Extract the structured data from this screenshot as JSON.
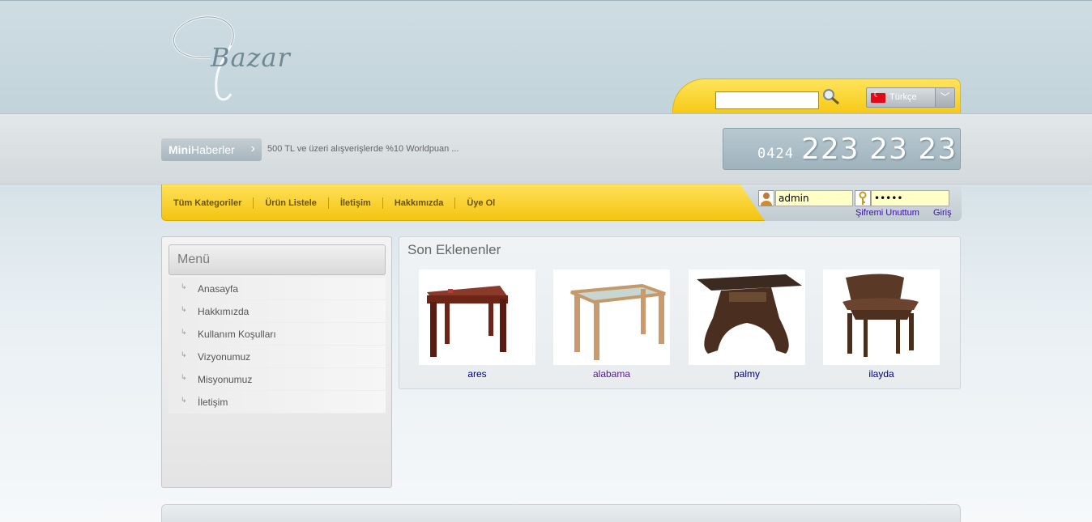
{
  "logo": {
    "text": "Bazar"
  },
  "search": {
    "placeholder": "",
    "value": ""
  },
  "language": {
    "selected": "Türkçe"
  },
  "mini_news": {
    "label_bold": "Mini",
    "label_rest": "Haberler",
    "text": "500 TL ve üzeri alışverişlerde %10 Worldpuan ..."
  },
  "phone": {
    "prefix": "0424",
    "number": "223 23 23"
  },
  "nav": {
    "items": [
      "Tüm Kategoriler",
      "Ürün Listele",
      "İletişim",
      "Hakkımızda",
      "Üye Ol"
    ]
  },
  "login": {
    "username": "admin",
    "password": "•••••",
    "forgot_label": "Şifremi Unuttum",
    "login_label": "Giriş"
  },
  "menu": {
    "title": "Menü",
    "items": [
      "Anasayfa",
      "Hakkımızda",
      "Kullanım Koşulları",
      "Vizyonumuz",
      "Misyonumuz",
      "İletişim"
    ]
  },
  "products": {
    "title": "Son Eklenenler",
    "items": [
      {
        "name": "ares",
        "visited": false
      },
      {
        "name": "alabama",
        "visited": true
      },
      {
        "name": "palmy",
        "visited": false
      },
      {
        "name": "ilayda",
        "visited": false
      }
    ]
  },
  "colors": {
    "accent_yellow": "#f6c915",
    "link_blue": "#00007e",
    "link_visited": "#551a8b"
  }
}
